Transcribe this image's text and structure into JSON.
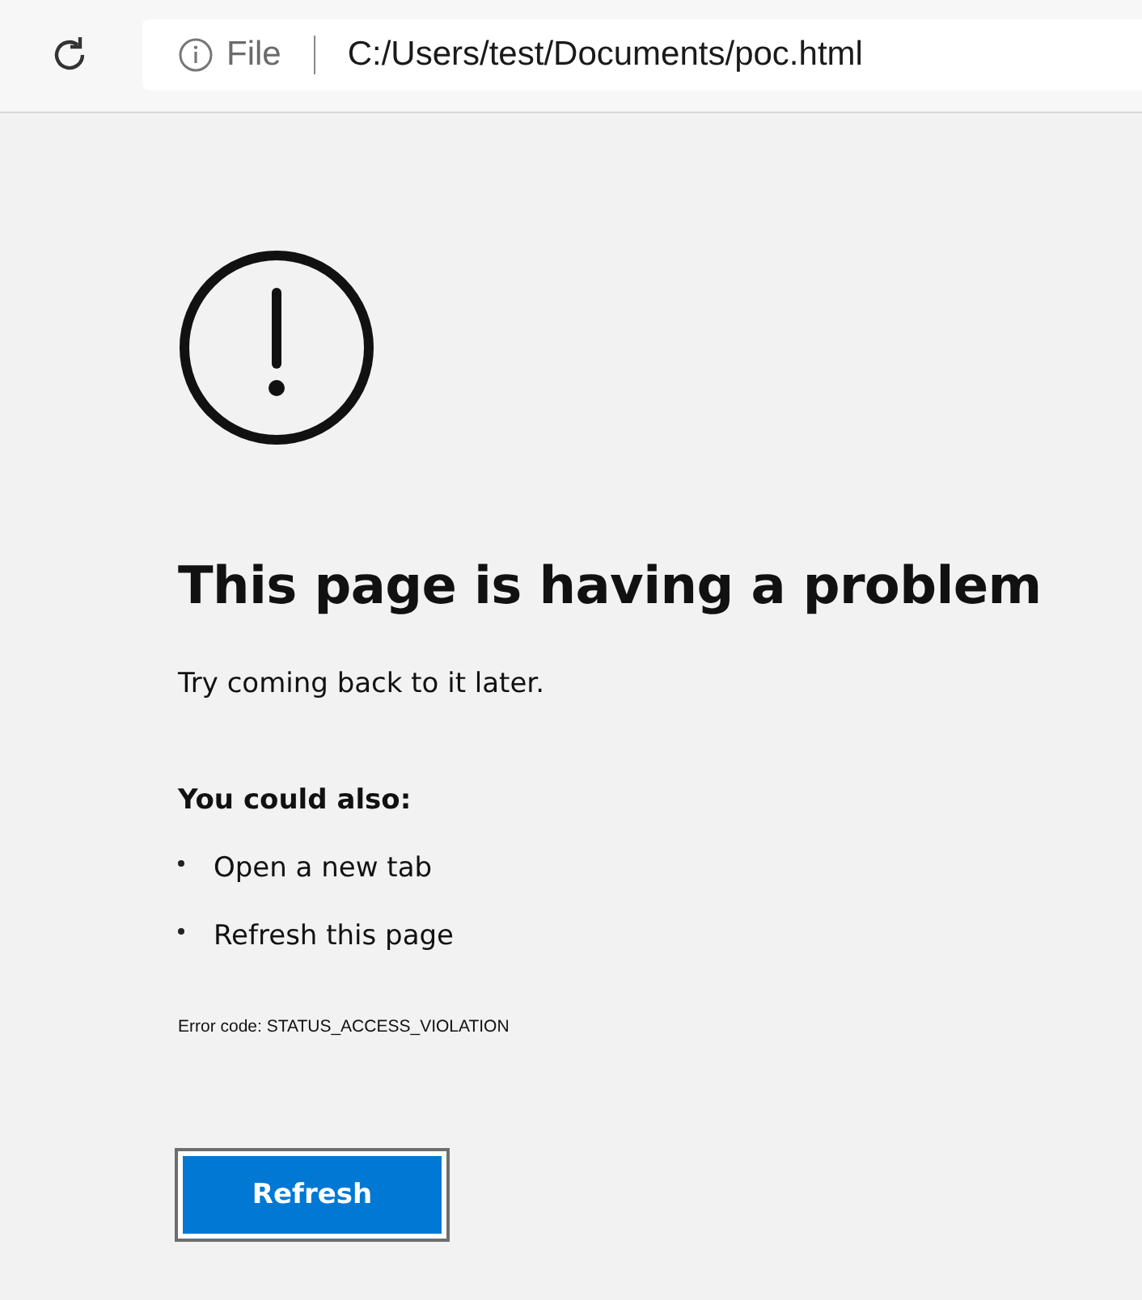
{
  "toolbar": {
    "address_bar": {
      "scheme_label": "File",
      "url": "C:/Users/test/Documents/poc.html"
    }
  },
  "error_page": {
    "heading": "This page is having a problem",
    "message": "Try coming back to it later.",
    "suggestions_heading": "You could also:",
    "suggestions": [
      "Open a new tab",
      "Refresh this page"
    ],
    "error_code": "Error code: STATUS_ACCESS_VIOLATION",
    "button": "Refresh"
  }
}
